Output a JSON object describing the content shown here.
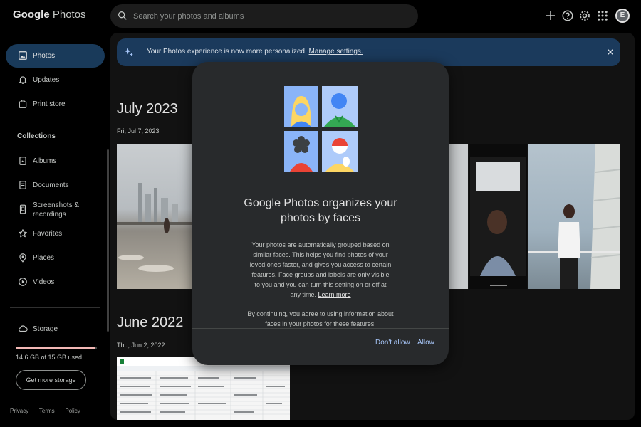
{
  "app": {
    "logo_google": "Google",
    "logo_product": "Photos"
  },
  "search": {
    "placeholder": "Search your photos and albums"
  },
  "user": {
    "initial": "E"
  },
  "sidebar": {
    "items": [
      {
        "label": "Photos",
        "icon": "photos-icon",
        "active": true
      },
      {
        "label": "Updates",
        "icon": "bell-icon"
      },
      {
        "label": "Print store",
        "icon": "shopping-bag-icon"
      }
    ],
    "collections_title": "Collections",
    "collections": [
      {
        "label": "Albums",
        "icon": "album-icon"
      },
      {
        "label": "Documents",
        "icon": "document-icon"
      },
      {
        "label": "Screenshots & recordings",
        "icon": "screenshot-icon"
      },
      {
        "label": "Favorites",
        "icon": "star-icon"
      },
      {
        "label": "Places",
        "icon": "map-pin-icon"
      },
      {
        "label": "Videos",
        "icon": "play-icon"
      }
    ],
    "storage": {
      "label": "Storage",
      "used_text": "14.6 GB of 15 GB used",
      "used_fraction": 0.973,
      "button": "Get more storage"
    },
    "footer": {
      "privacy": "Privacy",
      "terms": "Terms",
      "policy": "Policy"
    }
  },
  "banner": {
    "text": "Your Photos experience is now more personalized.",
    "link": "Manage settings."
  },
  "timeline": [
    {
      "month": "July 2023",
      "day": "Fri, Jul 7, 2023"
    },
    {
      "month": "June 2022",
      "day": "Thu, Jun 2, 2022"
    }
  ],
  "dialog": {
    "title": "Google Photos organizes your photos by faces",
    "body": "Your photos are automatically grouped based on similar faces. This helps you find photos of your loved ones faster, and gives you access to certain features. Face groups and labels are only visible to you and you can turn this setting on or off at any time.",
    "learn_more": "Learn more",
    "consent": "By continuing, you agree to using information about faces in your photos for these features.",
    "dont_allow": "Don't allow",
    "allow": "Allow"
  },
  "colors": {
    "active_nav": "#193a5a",
    "banner": "#1b3a5c",
    "dialog": "#282a2c",
    "accent_text": "#a8c7fa",
    "storage_fill": "#f2b8b5"
  }
}
